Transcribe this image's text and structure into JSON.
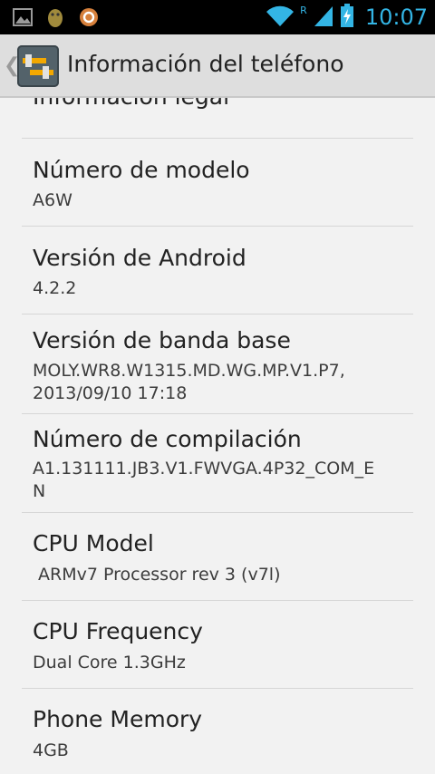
{
  "status_bar": {
    "time": "10:07",
    "roaming_indicator": "R",
    "left_icons": [
      "gallery-notification-icon",
      "android-debug-icon",
      "sync-notification-icon"
    ],
    "right_icons": [
      "wifi-icon",
      "signal-icon",
      "battery-charging-icon"
    ],
    "accent_color": "#33b5e5"
  },
  "action_bar": {
    "title": "Información del teléfono",
    "up_caret": "❮"
  },
  "items": [
    {
      "title": "Información legal",
      "summary": ""
    },
    {
      "title": "Número de modelo",
      "summary": "A6W"
    },
    {
      "title": "Versión de Android",
      "summary": "4.2.2"
    },
    {
      "title": "Versión de banda base",
      "summary": "MOLY.WR8.W1315.MD.WG.MP.V1.P7,\n2013/09/10 17:18"
    },
    {
      "title": "Número de compilación",
      "summary": "A1.131111.JB3.V1.FWVGA.4P32_COM_E\nN"
    },
    {
      "title": "CPU Model",
      "summary": " ARMv7 Processor rev 3 (v7l)"
    },
    {
      "title": "CPU Frequency",
      "summary": "Dual Core 1.3GHz"
    },
    {
      "title": "Phone Memory",
      "summary": "4GB"
    }
  ]
}
